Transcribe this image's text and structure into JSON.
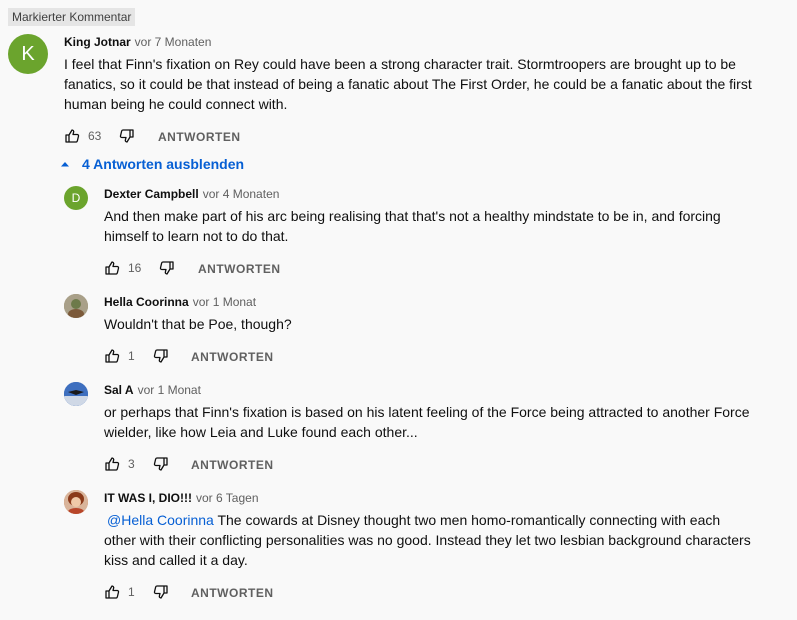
{
  "badge": "Markierter Kommentar",
  "comment": {
    "avatar_letter": "K",
    "avatar_color": "#6ba42d",
    "author": "King Jotnar",
    "time": "vor 7 Monaten",
    "text_lines": [
      "I feel that Finn's fixation on Rey could have been a strong character trait. Stormtroopers are brought up to be",
      "fanatics, so it could be that instead of being a fanatic about The First Order, he could be a fanatic about the first",
      "human being he could connect with."
    ],
    "likes": "63",
    "reply_label": "ANTWORTEN"
  },
  "toggle_label": "4 Antworten ausblenden",
  "replies": [
    {
      "avatar_letter": "D",
      "avatar_color": "#6ba42d",
      "author": "Dexter Campbell",
      "time": "vor 4 Monaten",
      "text_lines": [
        "And then make part of his arc being realising that that's not a healthy mindstate to be in, and forcing",
        "himself to learn not to do that."
      ],
      "likes": "16",
      "reply_label": "ANTWORTEN"
    },
    {
      "author": "Hella Coorinna",
      "time": "vor 1 Monat",
      "text_lines": [
        "Wouldn't that be Poe, though?"
      ],
      "likes": "1",
      "reply_label": "ANTWORTEN"
    },
    {
      "author": "Sal A",
      "time": "vor 1 Monat",
      "text_lines": [
        "or perhaps that Finn's fixation is based on his latent feeling of the Force being attracted to another Force",
        "wielder, like how Leia and Luke found each other..."
      ],
      "likes": "3",
      "reply_label": "ANTWORTEN"
    },
    {
      "author": "IT WAS I, DIO!!!",
      "time": "vor 6 Tagen",
      "mention": "@Hella Coorinna",
      "text_first_rest": " The cowards at Disney thought two men homo-romantically connecting with each",
      "text_lines": [
        "other with their conflicting personalities was no good. Instead they let two lesbian background characters",
        "kiss and called it a day."
      ],
      "likes": "1",
      "reply_label": "ANTWORTEN"
    }
  ],
  "colors": {
    "link": "#065fd4",
    "secondary": "#606060",
    "background": "#f9f9f9"
  },
  "icons": [
    "thumb-up-icon",
    "thumb-down-icon",
    "chevron-up-icon"
  ]
}
